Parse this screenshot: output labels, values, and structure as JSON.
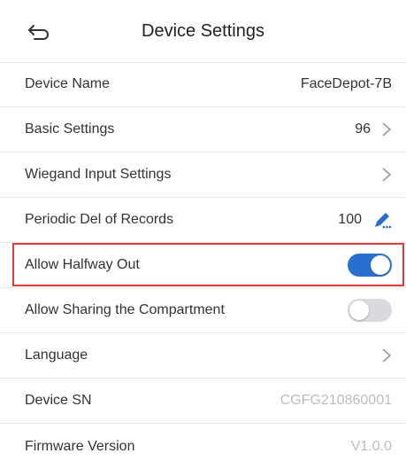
{
  "header": {
    "title": "Device Settings",
    "back_icon": "back-arrow-icon"
  },
  "colors": {
    "accent": "#2a6fcf",
    "highlight_border": "#e03c3c",
    "toggle_off": "#d9d9de"
  },
  "settings": [
    {
      "label": "Device Name",
      "value": "FaceDepot-7B"
    },
    {
      "label": "Basic Settings",
      "value": "96",
      "icon": "chevron-right-icon"
    },
    {
      "label": "Wiegand Input Settings",
      "icon": "chevron-right-icon"
    },
    {
      "label": "Periodic Del of Records",
      "value": "100",
      "icon": "edit-pen-icon"
    },
    {
      "label": "Allow Halfway Out",
      "toggle": true
    },
    {
      "label": "Allow Sharing the Compartment",
      "toggle": false
    },
    {
      "label": "Language",
      "icon": "chevron-right-icon"
    },
    {
      "label": "Device SN",
      "value": "CGFG210860001"
    },
    {
      "label": "Firmware Version",
      "value": "V1.0.0"
    }
  ]
}
